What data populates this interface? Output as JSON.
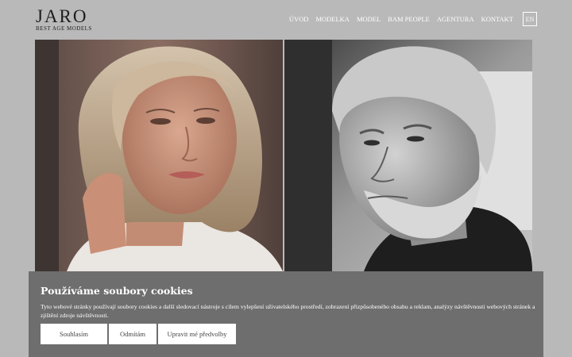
{
  "header": {
    "logo_main": "JARO",
    "logo_sub": "BEST AGE MODELS",
    "nav": [
      {
        "label": "ÚVOD"
      },
      {
        "label": "MODELKA"
      },
      {
        "label": "MODEL"
      },
      {
        "label": "BAM PEOPLE"
      },
      {
        "label": "AGENTURA"
      },
      {
        "label": "KONTAKT"
      }
    ],
    "language": "EN"
  },
  "hero": {
    "left_photo": "woman-portrait",
    "right_photo": "man-portrait-bw"
  },
  "cookie_banner": {
    "title": "Používáme soubory cookies",
    "text": "Tyto webové stránky používají soubory cookies a další sledovací nástroje s cílem vylepšení uživatelského prostředí, zobrazení přizpůsobeného obsahu a reklam, analýzy návštěvnosti webových stránek a zjištění zdroje návštěvnosti.",
    "accept": "Souhlasím",
    "reject": "Odmítám",
    "settings": "Upravit mé předvolby"
  },
  "colors": {
    "page_bg": "#b9b9b9",
    "banner_bg": "#6e6e6e",
    "text_dark": "#1d1d1d"
  }
}
